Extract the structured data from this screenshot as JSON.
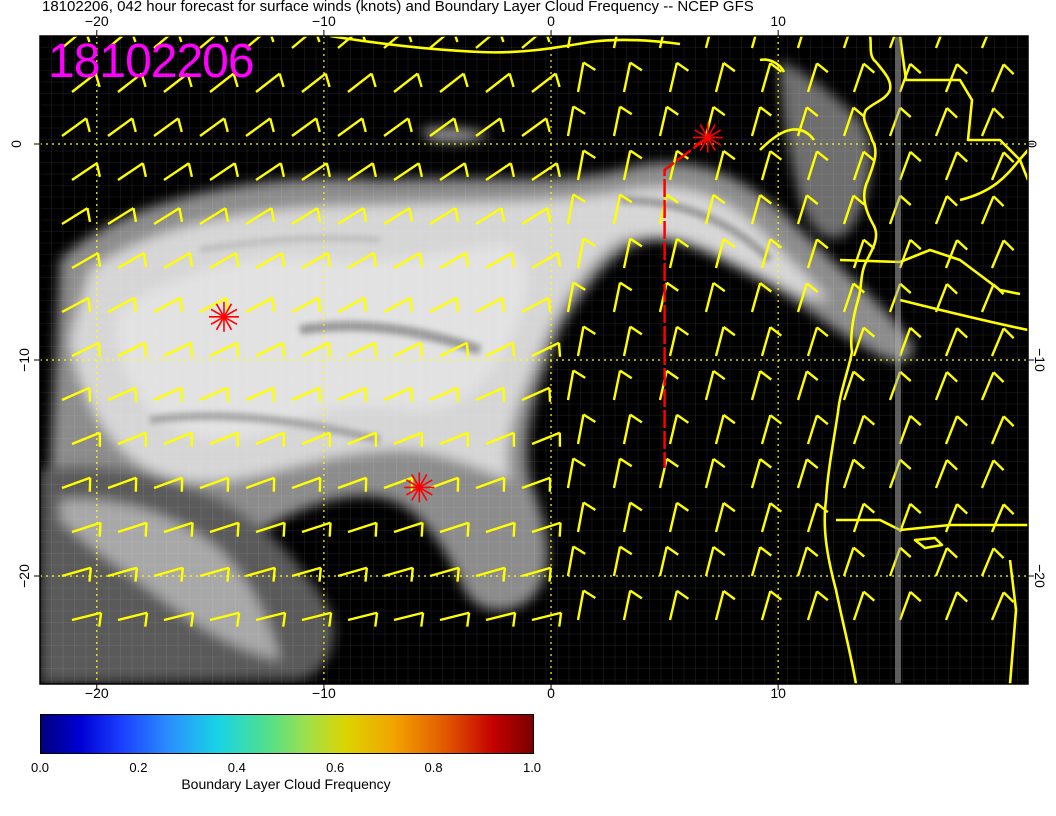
{
  "title": "18102206, 042 hour forecast for surface winds (knots) and Boundary Layer Cloud Frequency -- NCEP GFS",
  "date_label": "18102206",
  "map": {
    "lon_range": [
      -22.5,
      21
    ],
    "lat_range": [
      -25,
      5
    ],
    "lon_ticks": [
      "−20",
      "−10",
      "0",
      "10"
    ],
    "lon_tick_values": [
      -20,
      -10,
      0,
      10
    ],
    "lat_ticks": [
      "0",
      "−10",
      "−20"
    ],
    "lat_tick_values": [
      0,
      -10,
      -20
    ],
    "coast_color": "#ffff00",
    "barb_color": "#ffff00",
    "marker_color": "#ff0000",
    "markers": [
      {
        "lon": -14.4,
        "lat": -8.0
      },
      {
        "lon": -5.8,
        "lat": -15.9
      },
      {
        "lon": 6.9,
        "lat": 0.3
      }
    ],
    "flight_track": [
      [
        6.9,
        0.3
      ],
      [
        5.0,
        -1.2
      ],
      [
        5.0,
        -15.0
      ]
    ]
  },
  "colorbar": {
    "label": "Boundary Layer Cloud Frequency",
    "ticks": [
      "0.0",
      "0.2",
      "0.4",
      "0.6",
      "0.8",
      "1.0"
    ],
    "tick_values": [
      0.0,
      0.2,
      0.4,
      0.6,
      0.8,
      1.0
    ]
  }
}
